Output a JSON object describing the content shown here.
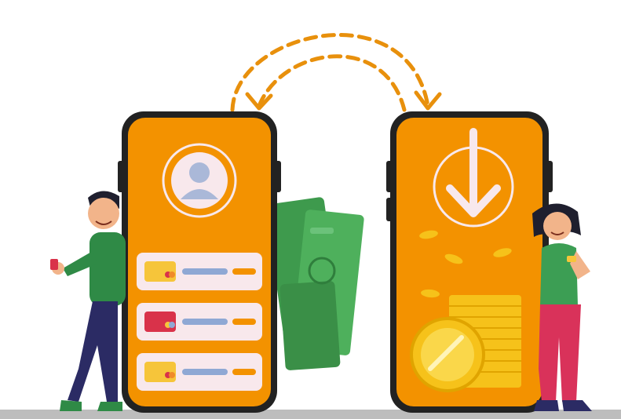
{
  "colors": {
    "phone_orange": "#f39200",
    "phone_frame": "#222222",
    "dash_arrow": "#e8900c",
    "cash_green": "#3e9a4d",
    "coin_gold": "#f6c21a",
    "shirt_green": "#2f8a46",
    "card_panel": "#f8e8ec",
    "card_yellow": "#f6c53a",
    "card_red": "#d9324a",
    "card_line_blue": "#8fa8d4",
    "avatar_blue": "#aab8d8",
    "ground_gray": "#bdbdbd"
  },
  "icons": {
    "left_phone_icon": "user-avatar-icon",
    "right_phone_icon": "arrow-down-icon",
    "top_arrows": "dashed-exchange-arrows"
  },
  "cards": [
    {
      "chip_color": "card-yellow"
    },
    {
      "chip_color": "card-red"
    },
    {
      "chip_color": "card-yellow"
    }
  ]
}
